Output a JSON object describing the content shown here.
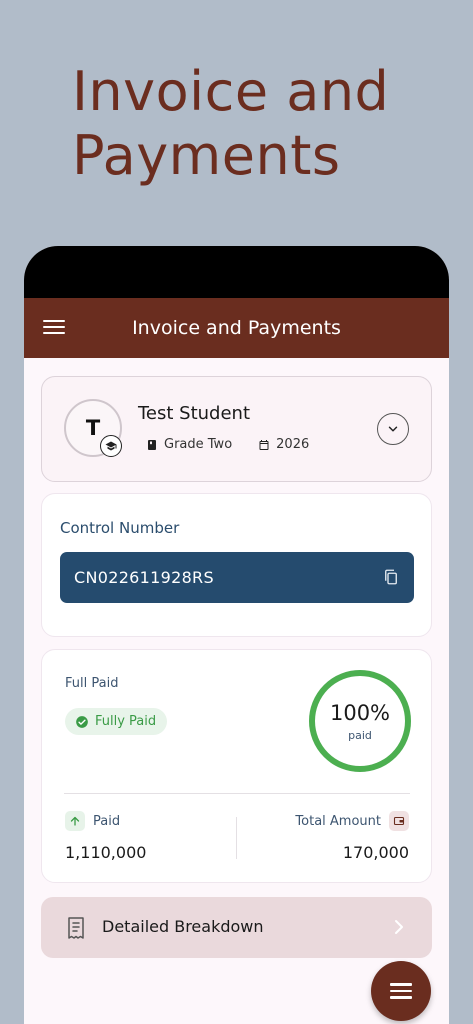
{
  "headline": "Invoice and Payments",
  "app_bar": {
    "title": "Invoice and Payments",
    "menu_icon": "menu-icon"
  },
  "student": {
    "avatar_initial": "T",
    "name": "Test Student",
    "grade": "Grade Two",
    "year": "2026",
    "badge_icon": "graduation-cap-icon",
    "expand_icon": "chevron-down-icon"
  },
  "control": {
    "label": "Control Number",
    "value": "CN022611928RS",
    "copy_icon": "copy-icon"
  },
  "payment": {
    "status_label": "Full Paid",
    "status_pill": "Fully Paid",
    "percent": "100%",
    "percent_sub": "paid",
    "progress_fraction": 1.0,
    "paid_label": "Paid",
    "paid_value": "1,110,000",
    "total_label": "Total Amount",
    "total_value": "170,000"
  },
  "breakdown": {
    "label": "Detailed Breakdown",
    "icon": "receipt-icon",
    "chevron": "chevron-right-icon"
  },
  "fab": {
    "icon": "menu-icon"
  },
  "colors": {
    "brand": "#6a2d1f",
    "control_bg": "#254b6e",
    "success": "#4caf50",
    "background": "#b1bcc9"
  }
}
